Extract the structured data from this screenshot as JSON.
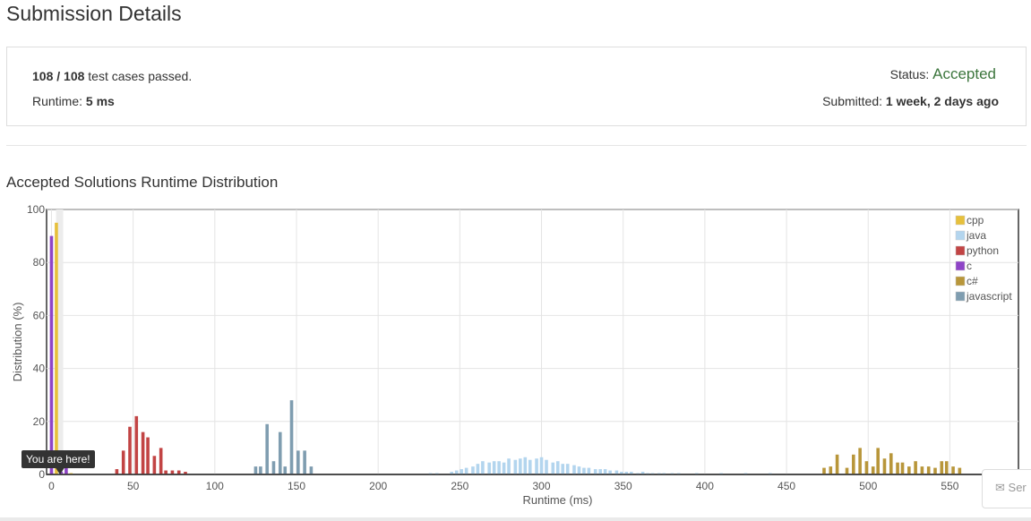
{
  "header": {
    "title": "Submission Details"
  },
  "summary": {
    "passed": "108 / 108",
    "passed_suffix": "test cases passed.",
    "runtime_label": "Runtime:",
    "runtime_value": "5 ms",
    "status_label": "Status:",
    "status_value": "Accepted",
    "status_color": "#3c763d",
    "submitted_label": "Submitted:",
    "submitted_value": "1 week, 2 days ago"
  },
  "section": {
    "title": "Accepted Solutions Runtime Distribution"
  },
  "tooltip": {
    "text": "You are here!"
  },
  "send_button": {
    "label": "Ser",
    "icon": "envelope-icon"
  },
  "chart_data": {
    "type": "bar",
    "xlabel": "Runtime (ms)",
    "ylabel": "Distribution (%)",
    "xlim": [
      -3,
      592
    ],
    "ylim": [
      0,
      100
    ],
    "xticks": [
      0,
      50,
      100,
      150,
      200,
      250,
      300,
      350,
      400,
      450,
      500,
      550
    ],
    "yticks": [
      0,
      20,
      40,
      60,
      80,
      100
    ],
    "grid": true,
    "legend_position": "top-right",
    "highlight_x": 5,
    "series": [
      {
        "name": "cpp",
        "color": "#e6c03c",
        "points": [
          [
            0,
            1
          ],
          [
            3,
            95
          ],
          [
            9,
            1
          ],
          [
            12,
            0.5
          ]
        ]
      },
      {
        "name": "java",
        "color": "#b3d5ee",
        "points": [
          [
            232,
            0.5
          ],
          [
            236,
            0.5
          ],
          [
            245,
            1
          ],
          [
            248,
            1.5
          ],
          [
            251,
            2
          ],
          [
            254,
            2.5
          ],
          [
            258,
            3
          ],
          [
            261,
            4
          ],
          [
            264,
            5
          ],
          [
            268,
            4.5
          ],
          [
            271,
            5
          ],
          [
            274,
            5
          ],
          [
            277,
            4.5
          ],
          [
            280,
            6
          ],
          [
            284,
            5.5
          ],
          [
            287,
            6
          ],
          [
            290,
            6.5
          ],
          [
            293,
            5.5
          ],
          [
            297,
            6
          ],
          [
            300,
            6.5
          ],
          [
            303,
            5.5
          ],
          [
            307,
            4.5
          ],
          [
            310,
            5
          ],
          [
            313,
            4
          ],
          [
            316,
            4
          ],
          [
            320,
            3.5
          ],
          [
            323,
            3
          ],
          [
            326,
            2.5
          ],
          [
            329,
            2.5
          ],
          [
            333,
            2
          ],
          [
            336,
            2
          ],
          [
            339,
            2
          ],
          [
            342,
            1.5
          ],
          [
            346,
            1.5
          ],
          [
            349,
            1
          ],
          [
            352,
            1
          ],
          [
            355,
            1
          ],
          [
            359,
            0.5
          ],
          [
            362,
            1
          ],
          [
            365,
            0.5
          ],
          [
            368,
            0.5
          ],
          [
            372,
            0.5
          ],
          [
            375,
            0.5
          ],
          [
            380,
            0.5
          ],
          [
            384,
            0.5
          ],
          [
            395,
            0.5
          ],
          [
            410,
            0.5
          ],
          [
            425,
            0.5
          ],
          [
            440,
            0.5
          ]
        ]
      },
      {
        "name": "python",
        "color": "#c24444",
        "points": [
          [
            40,
            2
          ],
          [
            44,
            9
          ],
          [
            48,
            18
          ],
          [
            52,
            22
          ],
          [
            56,
            16
          ],
          [
            59,
            14
          ],
          [
            63,
            7
          ],
          [
            67,
            10
          ],
          [
            70,
            1.5
          ],
          [
            74,
            1.5
          ],
          [
            78,
            1.5
          ],
          [
            82,
            1
          ]
        ]
      },
      {
        "name": "c",
        "color": "#8e44c7",
        "points": [
          [
            0,
            90
          ],
          [
            6,
            1
          ],
          [
            9,
            3
          ]
        ]
      },
      {
        "name": "c#",
        "color": "#b8963a",
        "points": [
          [
            473,
            2.5
          ],
          [
            477,
            3
          ],
          [
            481,
            7.5
          ],
          [
            487,
            2.5
          ],
          [
            491,
            7.5
          ],
          [
            495,
            10
          ],
          [
            499,
            5
          ],
          [
            503,
            3
          ],
          [
            506,
            10
          ],
          [
            510,
            6
          ],
          [
            514,
            8
          ],
          [
            518,
            4.5
          ],
          [
            521,
            4.5
          ],
          [
            525,
            3
          ],
          [
            529,
            5
          ],
          [
            533,
            3
          ],
          [
            537,
            3
          ],
          [
            541,
            2.5
          ],
          [
            545,
            5
          ],
          [
            548,
            5
          ],
          [
            552,
            3
          ],
          [
            556,
            2.5
          ],
          [
            590,
            2
          ]
        ]
      },
      {
        "name": "javascript",
        "color": "#7f9db0",
        "points": [
          [
            125,
            3
          ],
          [
            128,
            3
          ],
          [
            132,
            19
          ],
          [
            136,
            5
          ],
          [
            140,
            16
          ],
          [
            143,
            3
          ],
          [
            147,
            28
          ],
          [
            151,
            9
          ],
          [
            155,
            9
          ],
          [
            159,
            3
          ]
        ]
      }
    ]
  }
}
